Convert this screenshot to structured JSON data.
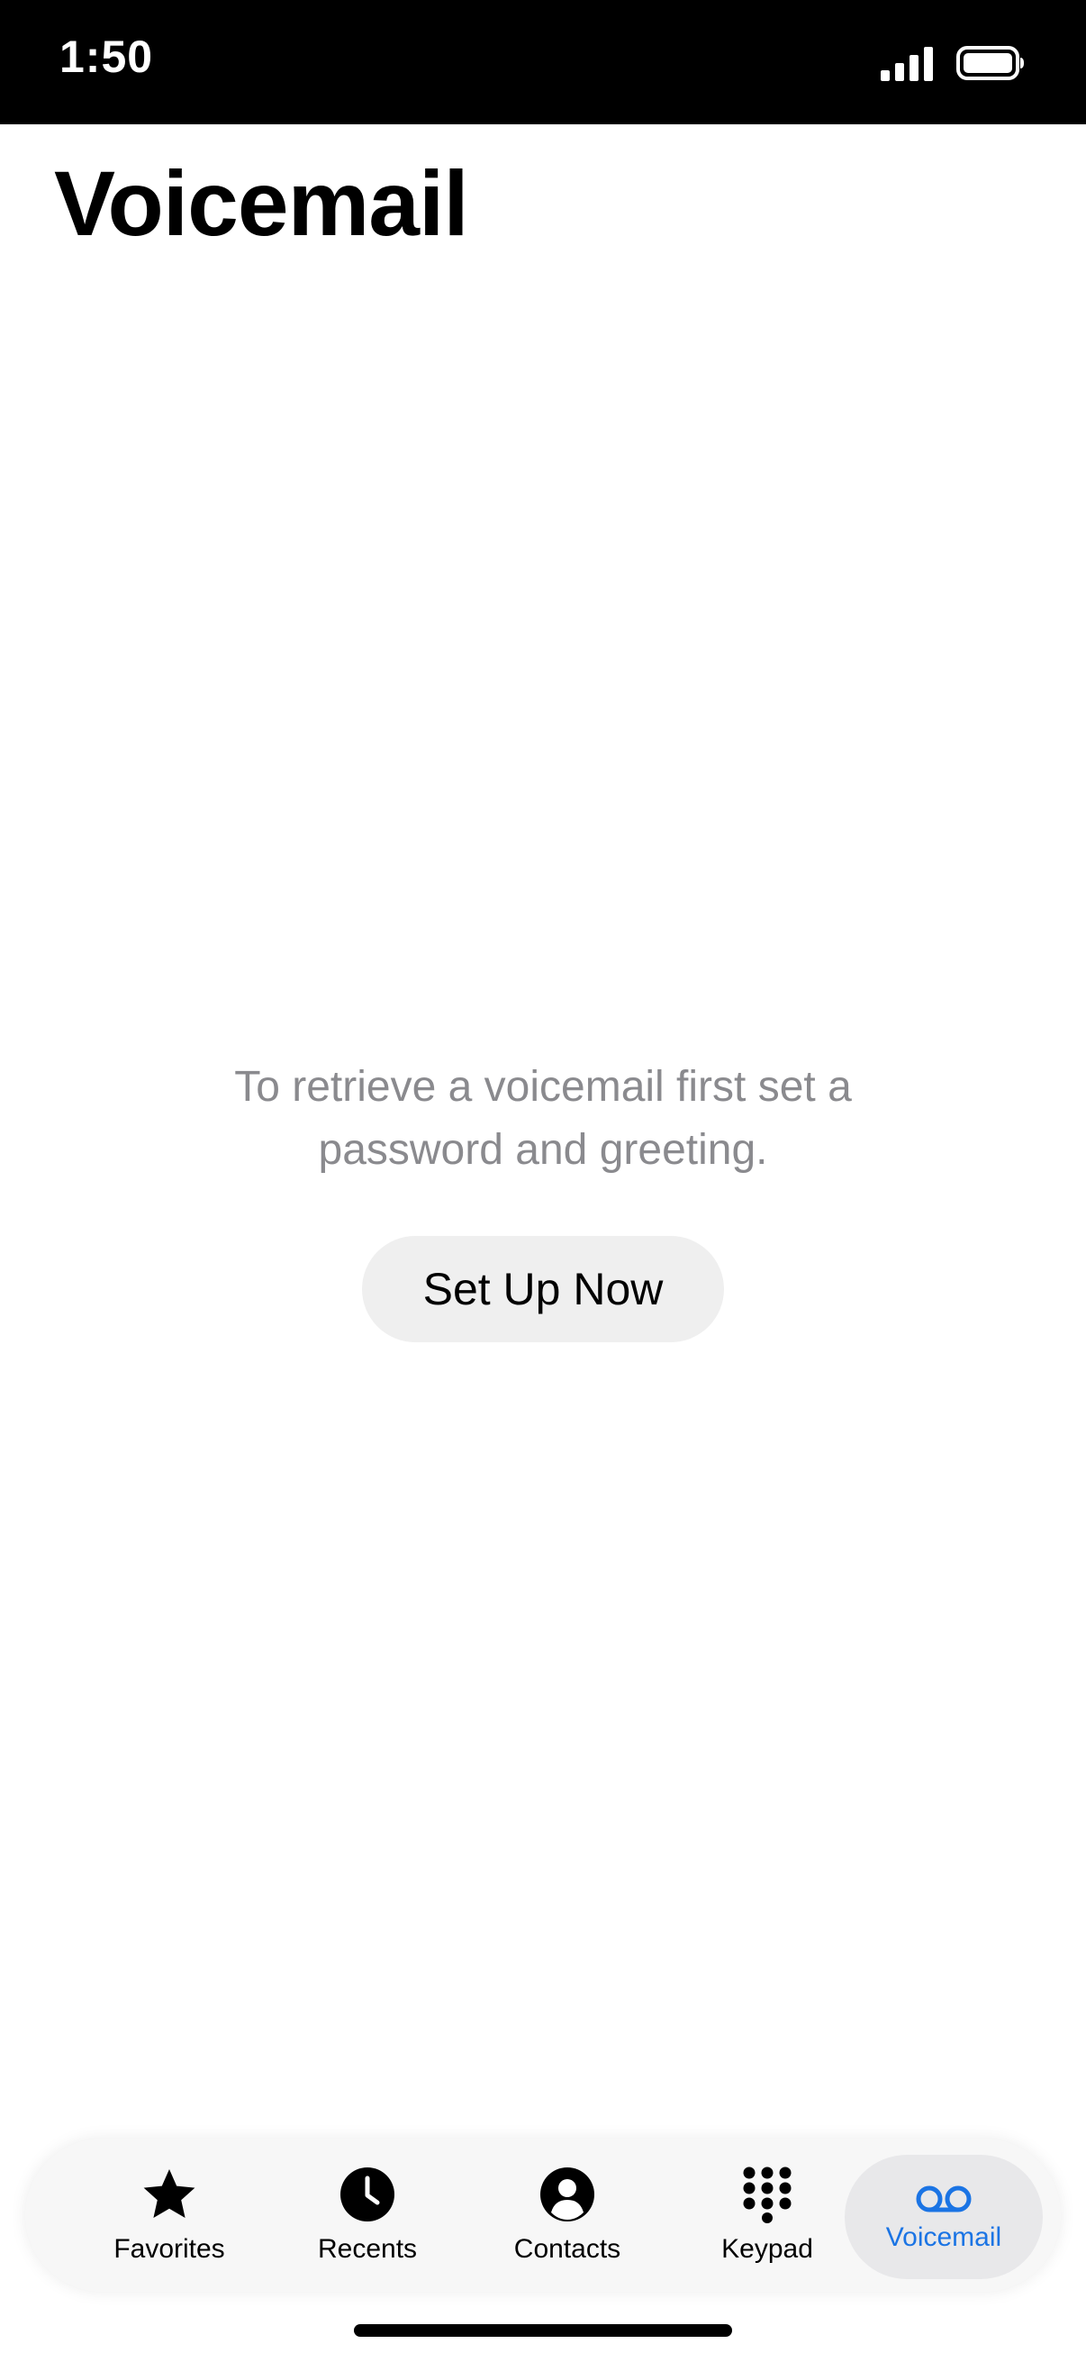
{
  "status_bar": {
    "time": "1:50",
    "signal_icon": "cellular-signal-icon",
    "battery_icon": "battery-icon"
  },
  "header": {
    "title": "Voicemail"
  },
  "empty_state": {
    "message": "To retrieve a voicemail first set a password and greeting.",
    "button_label": "Set Up Now"
  },
  "tab_bar": {
    "selected": "Voicemail",
    "accent_color": "#1b74e4",
    "tabs": [
      {
        "label": "Favorites",
        "icon": "star-icon"
      },
      {
        "label": "Recents",
        "icon": "clock-icon"
      },
      {
        "label": "Contacts",
        "icon": "person-circle-icon"
      },
      {
        "label": "Keypad",
        "icon": "keypad-icon"
      },
      {
        "label": "Voicemail",
        "icon": "voicemail-icon"
      }
    ]
  }
}
